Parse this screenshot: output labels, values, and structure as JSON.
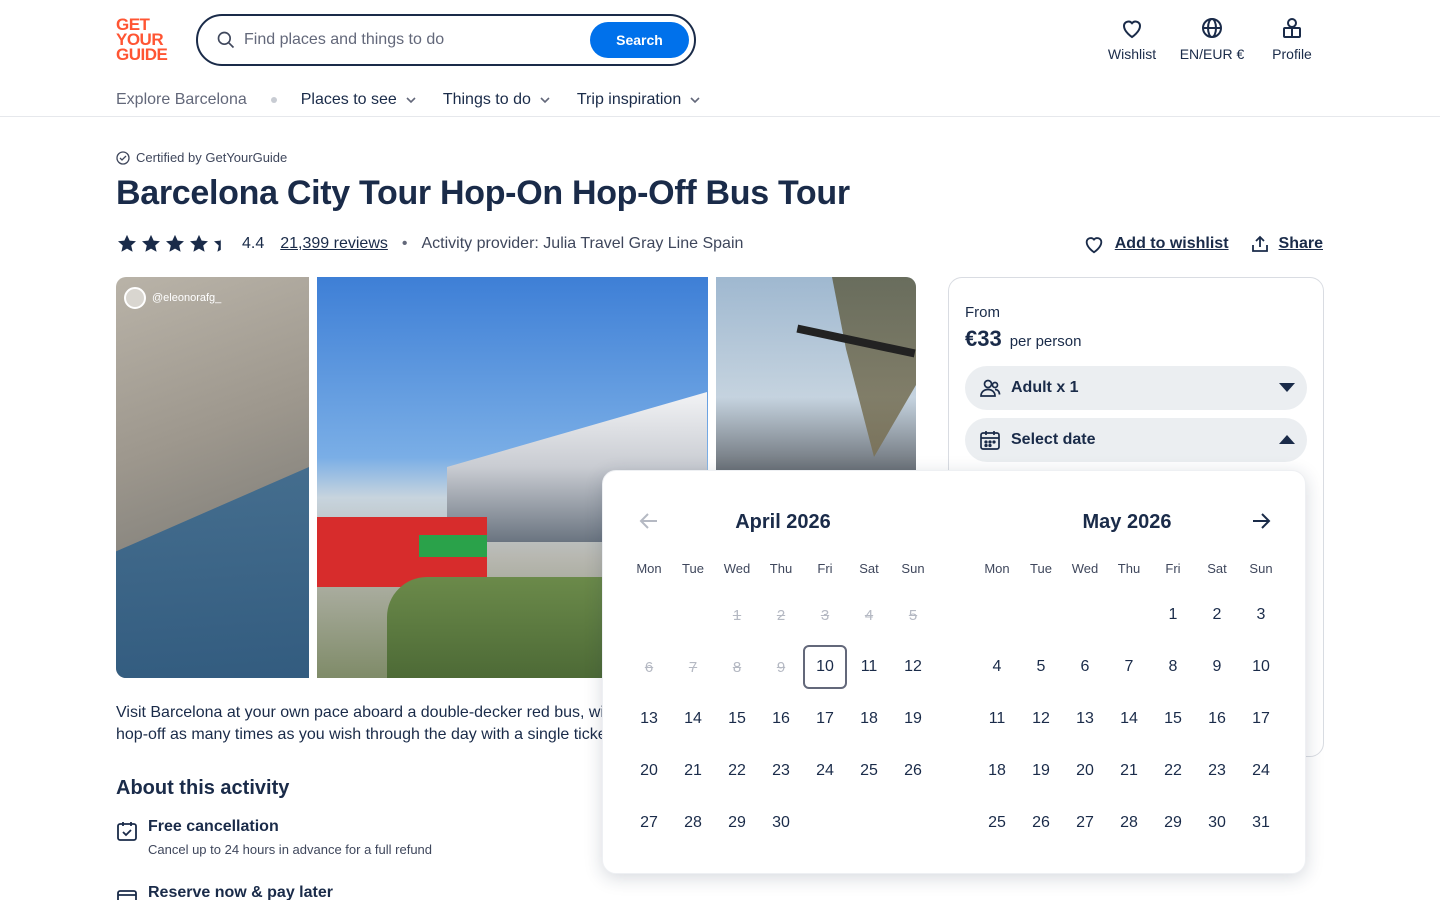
{
  "header": {
    "logo_lines": [
      "GET",
      "YOUR",
      "GUIDE"
    ],
    "search_placeholder": "Find places and things to do",
    "search_button": "Search",
    "nav": [
      {
        "label": "Wishlist",
        "icon": "heart-icon"
      },
      {
        "label": "EN/EUR €",
        "icon": "globe-icon"
      },
      {
        "label": "Profile",
        "icon": "profile-icon"
      }
    ]
  },
  "subnav": {
    "explore": "Explore Barcelona",
    "items": [
      "Places to see",
      "Things to do",
      "Trip inspiration"
    ]
  },
  "activity": {
    "certified": "Certified by GetYourGuide",
    "title": "Barcelona City Tour Hop-On Hop-Off Bus Tour",
    "rating": "4.4",
    "stars_filled": 4.4,
    "reviews": "21,399 reviews",
    "separator": "•",
    "provider": "Activity provider: Julia Travel Gray Line Spain",
    "add_to_wishlist": "Add to wishlist",
    "share": "Share",
    "photo_handle": "@eleonorafg_",
    "description_line1": "Visit Barcelona at your own pace aboard a double-decker red bus, with",
    "description_line2": "hop-off as many times as you wish through the day with a single ticket",
    "about_heading": "About this activity",
    "features": [
      {
        "title": "Free cancellation",
        "subtitle": "Cancel up to 24 hours in advance for a full refund",
        "icon": "calendar-check-icon"
      },
      {
        "title": "Reserve now & pay later",
        "subtitle": "",
        "icon": "wallet-icon"
      }
    ]
  },
  "booking": {
    "from_label": "From",
    "price": "€33",
    "per_person": "per person",
    "participants": "Adult x 1",
    "select_date": "Select date"
  },
  "calendar": {
    "weekdays": [
      "Mon",
      "Tue",
      "Wed",
      "Thu",
      "Fri",
      "Sat",
      "Sun"
    ],
    "months": [
      {
        "title": "April 2026",
        "offset": 2,
        "days": 30,
        "past_until": 9,
        "today": 10
      },
      {
        "title": "May 2026",
        "offset": 4,
        "days": 31,
        "past_until": 0,
        "today": 0
      }
    ]
  }
}
